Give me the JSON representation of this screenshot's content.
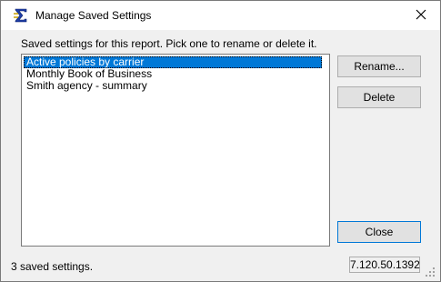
{
  "window": {
    "title": "Manage Saved Settings",
    "icon": "sigma-app-icon",
    "close_glyph": "✕"
  },
  "instruction": "Saved settings for this report. Pick one to rename or delete it.",
  "list": {
    "items": [
      {
        "label": "Active policies by carrier",
        "selected": true
      },
      {
        "label": "Monthly Book of Business",
        "selected": false
      },
      {
        "label": "Smith agency - summary",
        "selected": false
      }
    ]
  },
  "buttons": {
    "rename": "Rename...",
    "delete": "Delete",
    "close": "Close"
  },
  "status": {
    "count_text": "3 saved settings.",
    "version": "7.120.50.1392"
  },
  "colors": {
    "selection": "#0078d7",
    "window_bg": "#f0f0f0",
    "titlebar_bg": "#ffffff"
  }
}
